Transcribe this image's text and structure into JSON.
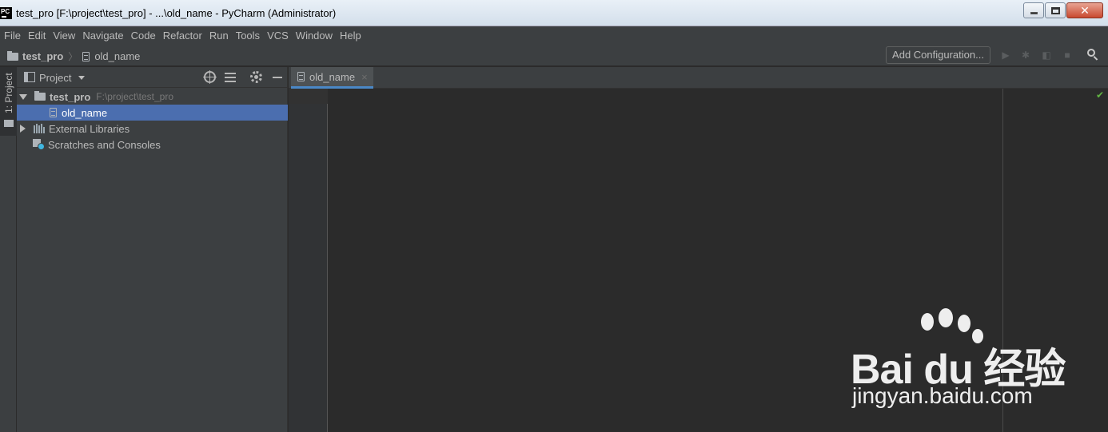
{
  "window": {
    "title": "test_pro [F:\\project\\test_pro] - ...\\old_name - PyCharm (Administrator)",
    "app_icon_text": "PC"
  },
  "menu": [
    "File",
    "Edit",
    "View",
    "Navigate",
    "Code",
    "Refactor",
    "Run",
    "Tools",
    "VCS",
    "Window",
    "Help"
  ],
  "navbar": {
    "project": "test_pro",
    "file": "old_name",
    "add_configuration": "Add Configuration..."
  },
  "stripe": {
    "project_tab": "1: Project"
  },
  "project_panel": {
    "title": "Project",
    "root_name": "test_pro",
    "root_path": "F:\\project\\test_pro",
    "file": "old_name",
    "external_libraries": "External Libraries",
    "scratches": "Scratches and Consoles"
  },
  "editor": {
    "tab_label": "old_name",
    "tab_close": "×",
    "status_ok": "✔"
  },
  "watermark": {
    "brand": "Bai du 经验",
    "url": "jingyan.baidu.com"
  },
  "colors": {
    "selection": "#4b6eaf",
    "editor_bg": "#2b2b2b",
    "panel_bg": "#3c3f41",
    "ok_check": "#62b543"
  }
}
